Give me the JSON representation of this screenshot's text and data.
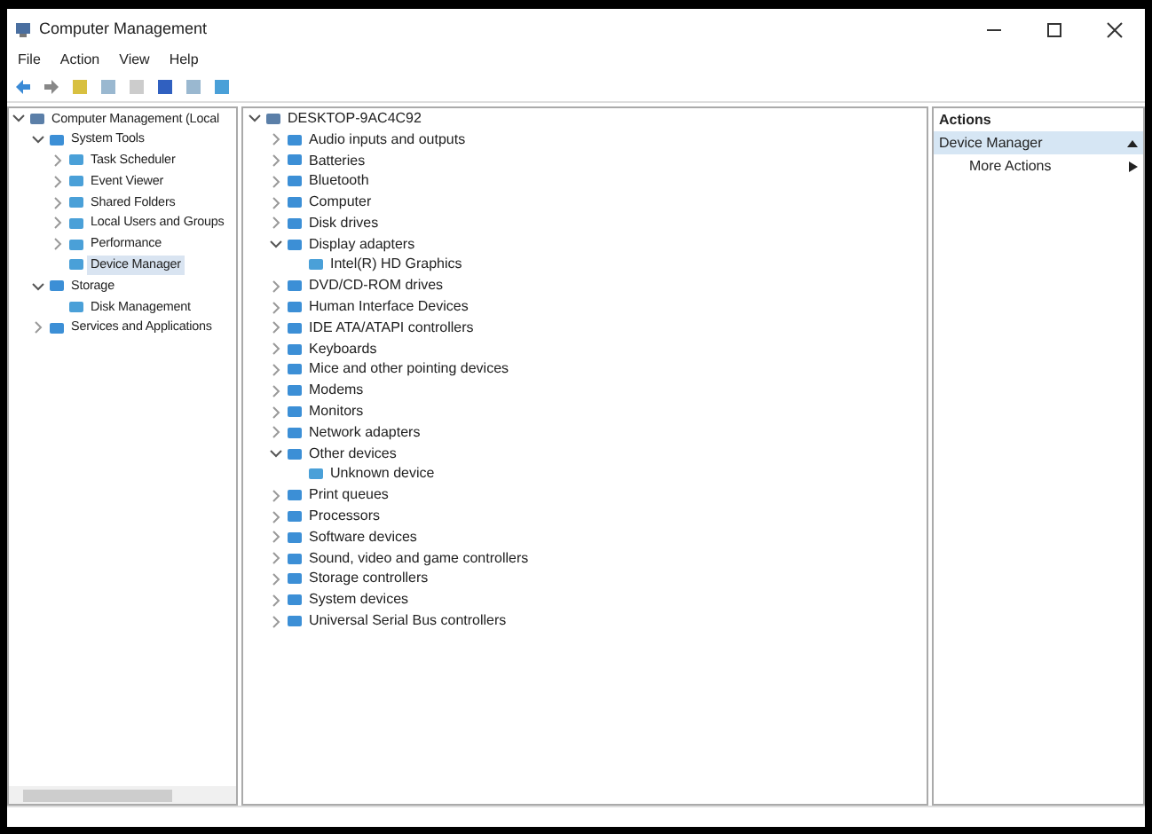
{
  "window": {
    "title": "Computer Management"
  },
  "menu": [
    "File",
    "Action",
    "View",
    "Help"
  ],
  "nav_tree": [
    {
      "label": "Computer Management (Local",
      "expanded": true,
      "selected": false,
      "children": [
        {
          "label": "System Tools",
          "expanded": true,
          "selected": false,
          "children": [
            {
              "label": "Task Scheduler",
              "expanded": false,
              "selected": false
            },
            {
              "label": "Event Viewer",
              "expanded": false,
              "selected": false
            },
            {
              "label": "Shared Folders",
              "expanded": false,
              "selected": false
            },
            {
              "label": "Local Users and Groups",
              "expanded": false,
              "selected": false
            },
            {
              "label": "Performance",
              "expanded": false,
              "selected": false
            },
            {
              "label": "Device Manager",
              "selected": true
            }
          ]
        },
        {
          "label": "Storage",
          "expanded": true,
          "selected": false,
          "children": [
            {
              "label": "Disk Management",
              "selected": false
            }
          ]
        },
        {
          "label": "Services and Applications",
          "expanded": false,
          "selected": false
        }
      ]
    }
  ],
  "device_tree": {
    "label": "DESKTOP-9AC4C92",
    "expanded": true,
    "children": [
      {
        "label": "Audio inputs and outputs",
        "expanded": false
      },
      {
        "label": "Batteries",
        "expanded": false
      },
      {
        "label": "Bluetooth",
        "expanded": false
      },
      {
        "label": "Computer",
        "expanded": false
      },
      {
        "label": "Disk drives",
        "expanded": false
      },
      {
        "label": "Display adapters",
        "expanded": true,
        "children": [
          {
            "label": "Intel(R) HD Graphics"
          }
        ]
      },
      {
        "label": "DVD/CD-ROM drives",
        "expanded": false
      },
      {
        "label": "Human Interface Devices",
        "expanded": false
      },
      {
        "label": "IDE ATA/ATAPI controllers",
        "expanded": false
      },
      {
        "label": "Keyboards",
        "expanded": false
      },
      {
        "label": "Mice and other pointing devices",
        "expanded": false
      },
      {
        "label": "Modems",
        "expanded": false
      },
      {
        "label": "Monitors",
        "expanded": false
      },
      {
        "label": "Network adapters",
        "expanded": false
      },
      {
        "label": "Other devices",
        "expanded": true,
        "children": [
          {
            "label": "Unknown device"
          }
        ]
      },
      {
        "label": "Print queues",
        "expanded": false
      },
      {
        "label": "Processors",
        "expanded": false
      },
      {
        "label": "Software devices",
        "expanded": false
      },
      {
        "label": "Sound, video and game controllers",
        "expanded": false
      },
      {
        "label": "Storage controllers",
        "expanded": false
      },
      {
        "label": "System devices",
        "expanded": false
      },
      {
        "label": "Universal Serial Bus controllers",
        "expanded": false
      }
    ]
  },
  "actions": {
    "title": "Actions",
    "section": "Device Manager",
    "items": [
      "More Actions"
    ]
  }
}
